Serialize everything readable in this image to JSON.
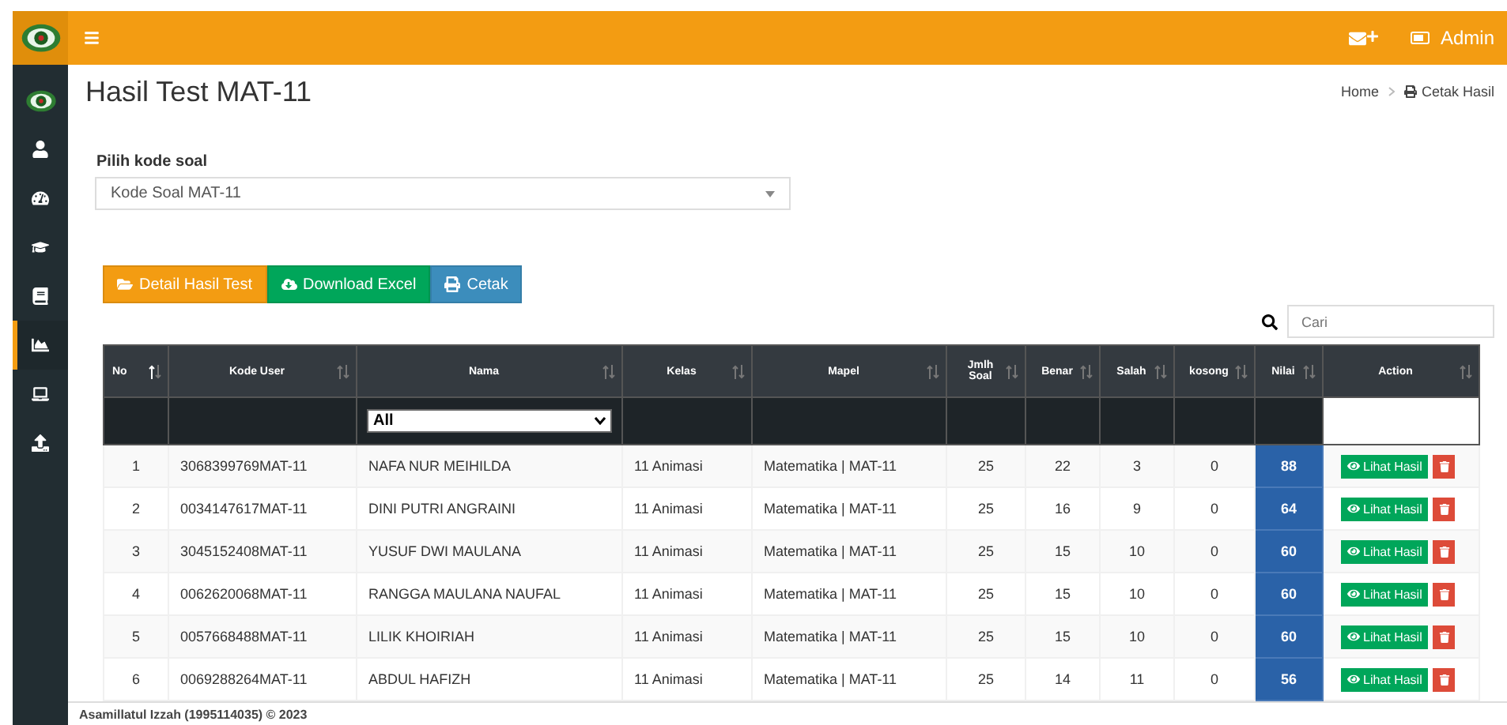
{
  "topbar": {
    "user": "Admin"
  },
  "sidebar": {
    "items": [
      {
        "kind": "logo",
        "selected": false
      },
      {
        "kind": "user",
        "selected": false
      },
      {
        "kind": "dashboard",
        "selected": false
      },
      {
        "kind": "cap",
        "selected": false
      },
      {
        "kind": "book",
        "selected": false
      },
      {
        "kind": "chart",
        "selected": true
      },
      {
        "kind": "laptop",
        "selected": false
      },
      {
        "kind": "upload",
        "selected": false
      }
    ]
  },
  "page": {
    "title": "Hasil Test MAT-11",
    "breadcrumb": [
      "Home",
      "Cetak Hasil"
    ]
  },
  "form": {
    "label": "Pilih kode soal",
    "value": "Kode Soal MAT-11"
  },
  "buttons": [
    {
      "kind": "detail",
      "label": "Detail Hasil Test"
    },
    {
      "kind": "excel",
      "label": "Download Excel"
    },
    {
      "kind": "print",
      "label": "Cetak"
    }
  ],
  "search": {
    "placeholder": "Cari"
  },
  "table": {
    "columns": [
      {
        "label": "No",
        "sorted": true
      },
      {
        "label": "Kode User",
        "sorted": false
      },
      {
        "label": "Nama",
        "sorted": false
      },
      {
        "label": "Kelas",
        "sorted": false
      },
      {
        "label": "Mapel",
        "sorted": false
      },
      {
        "label": "Jmlh Soal",
        "sorted": false
      },
      {
        "label": "Benar",
        "sorted": false
      },
      {
        "label": "Salah",
        "sorted": false
      },
      {
        "label": "kosong",
        "sorted": false
      },
      {
        "label": "Nilai",
        "sorted": false
      },
      {
        "label": "Action",
        "sorted": false
      }
    ],
    "filter": {
      "value": "All"
    },
    "rows": [
      {
        "cells": [
          "1",
          "3068399769MAT-11",
          "NAFA NUR MEIHILDA",
          "11 Animasi",
          "Matematika | MAT-11",
          "25",
          "22",
          "3",
          "0",
          "88"
        ],
        "action": "Lihat Hasil"
      },
      {
        "cells": [
          "2",
          "0034147617MAT-11",
          "DINI PUTRI ANGRAINI",
          "11 Animasi",
          "Matematika | MAT-11",
          "25",
          "16",
          "9",
          "0",
          "64"
        ],
        "action": "Lihat Hasil"
      },
      {
        "cells": [
          "3",
          "3045152408MAT-11",
          "YUSUF DWI MAULANA",
          "11 Animasi",
          "Matematika | MAT-11",
          "25",
          "15",
          "10",
          "0",
          "60"
        ],
        "action": "Lihat Hasil"
      },
      {
        "cells": [
          "4",
          "0062620068MAT-11",
          "RANGGA MAULANA NAUFAL",
          "11 Animasi",
          "Matematika | MAT-11",
          "25",
          "15",
          "10",
          "0",
          "60"
        ],
        "action": "Lihat Hasil"
      },
      {
        "cells": [
          "5",
          "0057668488MAT-11",
          "LILIK KHOIRIAH",
          "11 Animasi",
          "Matematika | MAT-11",
          "25",
          "15",
          "10",
          "0",
          "60"
        ],
        "action": "Lihat Hasil"
      },
      {
        "cells": [
          "6",
          "0069288264MAT-11",
          "ABDUL HAFIZH",
          "11 Animasi",
          "Matematika | MAT-11",
          "25",
          "14",
          "11",
          "0",
          "56"
        ],
        "action": "Lihat Hasil"
      }
    ]
  },
  "footer": "Asamillatul Izzah (1995114035) © 2023"
}
